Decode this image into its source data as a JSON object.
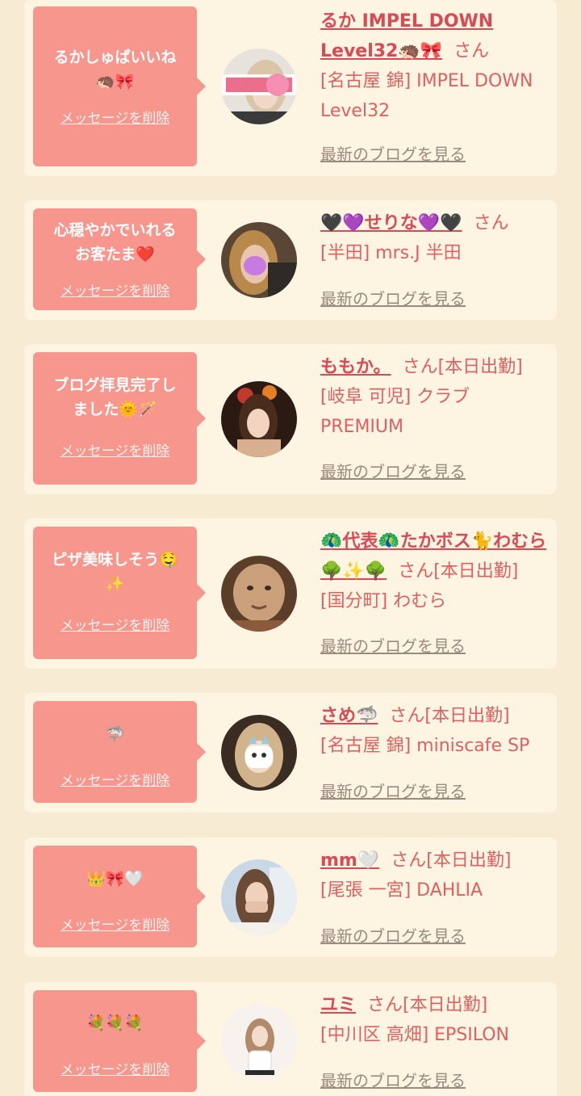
{
  "messages": [
    {
      "message": "るかしゅぱいいね\n🦔🎀",
      "delete_label": "メッセージを削除",
      "name": "るか IMPEL DOWN Level32🦔🎀",
      "suffix": "さん",
      "location": "[名古屋 錦] IMPEL DOWN Level32",
      "blog_label": "最新のブログを見る"
    },
    {
      "message": "心穏やかでいれる\nお客たま❤️",
      "delete_label": "メッセージを削除",
      "name": "🖤💜せりな💜🖤",
      "suffix": "さん",
      "location": "[半田] mrs.J 半田",
      "blog_label": "最新のブログを見る"
    },
    {
      "message": "ブログ拝見完了し\nました🌞🪄",
      "delete_label": "メッセージを削除",
      "name": "ももか。",
      "suffix": "さん[本日出勤]",
      "location": "[岐阜 可児] クラブ PREMIUM",
      "blog_label": "最新のブログを見る"
    },
    {
      "message": "ピザ美味しそう🤤\n✨",
      "delete_label": "メッセージを削除",
      "name": "🦚代表🦚たかボス🐈わむら🌳✨🌳",
      "suffix": "さん[本日出勤]",
      "location": "[国分町] わむら",
      "blog_label": "最新のブログを見る"
    },
    {
      "message": "🦈",
      "delete_label": "メッセージを削除",
      "name": "さめ🦈",
      "suffix": "さん[本日出勤]",
      "location": "[名古屋 錦] miniscafe SP",
      "blog_label": "最新のブログを見る"
    },
    {
      "message": "👑🎀🤍",
      "delete_label": "メッセージを削除",
      "name": "mm🤍",
      "suffix": "さん[本日出勤]",
      "location": "[尾張 一宮] DAHLIA",
      "blog_label": "最新のブログを見る"
    },
    {
      "message": "💐💐💐",
      "delete_label": "メッセージを削除",
      "name": "ユミ",
      "suffix": "さん[本日出勤]",
      "location": "[中川区 高畑] EPSILON",
      "blog_label": "最新のブログを見る"
    }
  ],
  "colors": {
    "page_background": "#f7ebd3",
    "card_background": "#fdf4e2",
    "bubble": "#f7968c",
    "name_link": "#d94a55",
    "text": "#e06060",
    "blog_link": "#9a8a80"
  }
}
